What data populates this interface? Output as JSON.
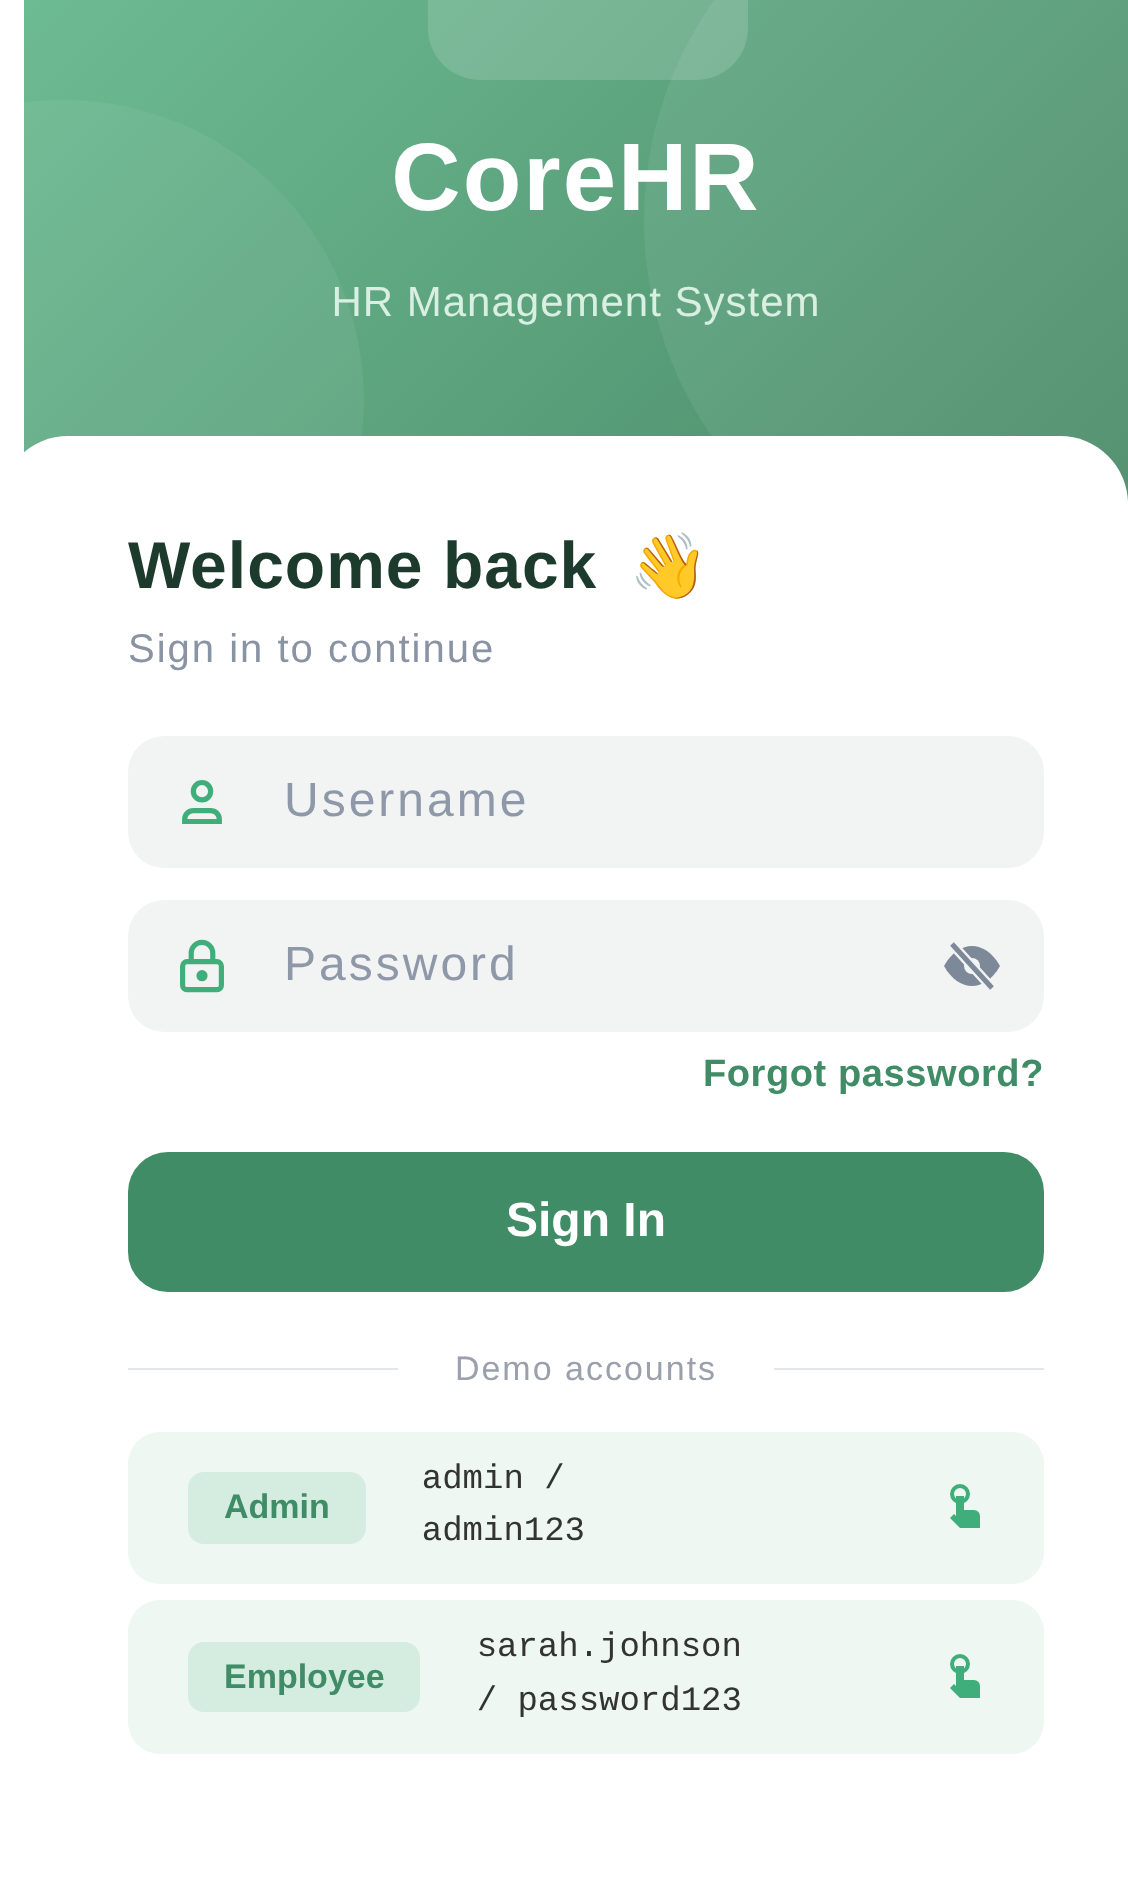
{
  "header": {
    "title": "CoreHR",
    "subtitle": "HR Management System"
  },
  "welcome": {
    "title": "Welcome back",
    "emoji": "👋",
    "subtitle": "Sign in to continue"
  },
  "fields": [
    {
      "kind": "username",
      "placeholder": "Username"
    },
    {
      "kind": "password",
      "placeholder": "Password"
    }
  ],
  "forgot_link": "Forgot password?",
  "sign_in_button": "Sign In",
  "demo_divider": "Demo accounts",
  "demo_accounts": [
    {
      "role": "Admin",
      "credentials": "admin / admin123"
    },
    {
      "role": "Employee",
      "credentials": "sarah.johnson / password123"
    }
  ]
}
